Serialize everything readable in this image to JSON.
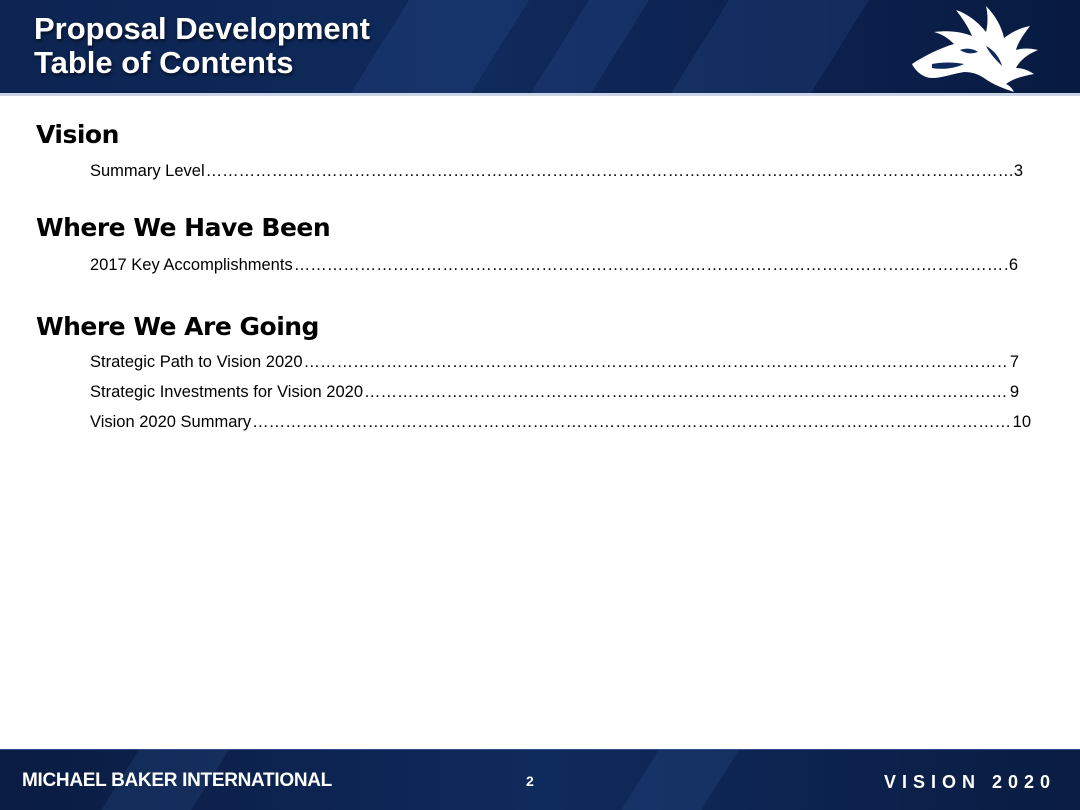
{
  "header": {
    "title_line1": "Proposal Development",
    "title_line2": "Table of Contents"
  },
  "sections": [
    {
      "heading": "Vision",
      "items": [
        {
          "label": "Summary Level",
          "page": "3"
        }
      ]
    },
    {
      "heading": "Where We Have Been",
      "items": [
        {
          "label": "2017 Key Accomplishments ",
          "page": "6"
        }
      ]
    },
    {
      "heading": "Where We Are Going",
      "items": [
        {
          "label": "Strategic Path to Vision 2020",
          "page": "7"
        },
        {
          "label": "Strategic Investments for Vision 2020",
          "page": "9"
        },
        {
          "label": "Vision 2020 Summary",
          "page": " 10"
        }
      ]
    }
  ],
  "footer": {
    "company": "MICHAEL BAKER INTERNATIONAL",
    "page_number": "2",
    "tagline": "VISION 2020"
  },
  "colors": {
    "navy": "#0f2a5c",
    "white": "#ffffff"
  },
  "icons": {
    "logo": "wolf-head-logo"
  }
}
